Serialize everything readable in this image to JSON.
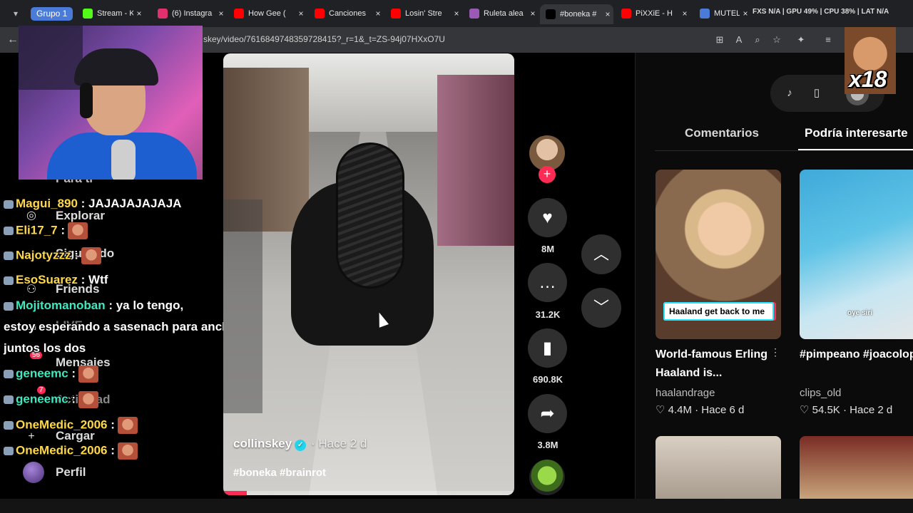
{
  "tabstrip": {
    "group_label": "Grupo 1",
    "tabs": [
      {
        "title": "Stream - K",
        "icon": "kick-icon",
        "color": "#53fc18",
        "active": false
      },
      {
        "title": "(6) Instagra",
        "icon": "instagram-icon",
        "color": "#e1306c",
        "active": false
      },
      {
        "title": "How Gee (",
        "icon": "youtube-icon",
        "color": "#ff0000",
        "active": false
      },
      {
        "title": "Canciones",
        "icon": "youtube-icon",
        "color": "#ff0000",
        "active": false
      },
      {
        "title": "Losin' Stre",
        "icon": "youtube-icon",
        "color": "#ff0000",
        "active": false
      },
      {
        "title": "Ruleta alea",
        "icon": "wheel-icon",
        "color": "#9b59b6",
        "active": false
      },
      {
        "title": "#boneka #",
        "icon": "tiktok-icon",
        "color": "#000000",
        "active": true
      },
      {
        "title": "PiXXiE - H",
        "icon": "youtube-icon",
        "color": "#ff0000",
        "active": false
      },
      {
        "title": "MUTELU t",
        "icon": "search-icon",
        "color": "#4a7bd8",
        "active": false
      }
    ],
    "system_stats": "FXS N/A | GPU 49% | CPU 38% | LAT N/A"
  },
  "navbar": {
    "url": "skey/video/7616849748359728415?_r=1&_t=ZS-94j07HXxO7U"
  },
  "tiktok_nav": {
    "para_ti": "Para ti",
    "explorar": "Explorar",
    "siguiendo": "Siguiendo",
    "friends": "Friends",
    "live": "LIVE",
    "mensajes": "Mensajes",
    "mensajes_badge": "56",
    "actividad": "Actividad",
    "actividad_badge": "7",
    "cargar": "Cargar",
    "perfil": "Perfil"
  },
  "chat": [
    {
      "user": "Magui_890",
      "color": "#ffd84a",
      "text": " : JAJAJAJAJAJA"
    },
    {
      "user": "Eli17_7",
      "color": "#ffd84a",
      "text": " :"
    },
    {
      "user": "Najotyzzz",
      "color": "#ffd84a",
      "text": " :"
    },
    {
      "user": "EsoSuarez",
      "color": "#ffd84a",
      "text": " : Wtf"
    },
    {
      "user": "Mojitomanoban",
      "color": "#3fe9c0",
      "text": " : ya lo tengo,"
    },
    {
      "user": "geneemc",
      "color": "#3fe9c0",
      "text": " :"
    },
    {
      "user": "geneemc",
      "color": "#3fe9c0",
      "text": " :"
    },
    {
      "user": "OneMedic_2006",
      "color": "#ffd84a",
      "text": " :"
    },
    {
      "user": "OneMedic_2006",
      "color": "#ffd84a",
      "text": " :"
    }
  ],
  "chat_wrap": "estoy esperando a sasenach para anclar juntos los dos",
  "video": {
    "author": "collinskey",
    "age": "· Hace 2 d",
    "hashtags": "#boneka #brainrot",
    "progress_fraction": 0.08
  },
  "actions": {
    "likes": "8M",
    "comments": "31.2K",
    "saves": "690.8K",
    "shares": "3.8M"
  },
  "right_panel": {
    "tab_comments": "Comentarios",
    "tab_suggested": "Podría interesarte",
    "cards": [
      {
        "caption": "Haaland get back to me",
        "title": "World-famous Erling Haaland is...",
        "author": "haalandrage",
        "stats": "♡ 4.4M · Hace 6 d"
      },
      {
        "caption": "oye siri",
        "title": "#pimpeano #joacolopez...",
        "author": "clips_old",
        "stats": "♡ 54.5K · Hace 2 d"
      }
    ]
  },
  "overlay": {
    "meme_text": "x18"
  }
}
